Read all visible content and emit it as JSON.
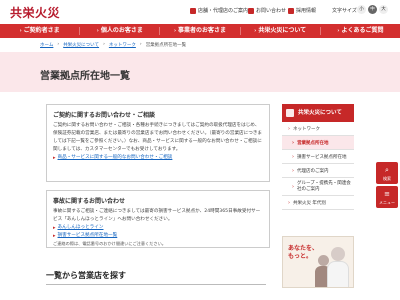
{
  "header": {
    "logo": "共栄火災",
    "util_links": [
      {
        "label": "店舗・代理店のご案内",
        "icon": "location-icon"
      },
      {
        "label": "お問い合わせ",
        "icon": "mail-icon"
      },
      {
        "label": "採用情報",
        "icon": "person-icon"
      }
    ],
    "font_size_label": "文字サイズ",
    "font_sizes": [
      "小",
      "中",
      "大"
    ],
    "font_size_selected": "中"
  },
  "nav": {
    "items": [
      "ご契約者さま",
      "個人のお客さま",
      "事業者のお客さま",
      "共栄火災について",
      "よくあるご質問"
    ]
  },
  "breadcrumb": [
    "ホーム",
    "共栄火災について",
    "ネットワーク",
    "営業拠点所在地一覧"
  ],
  "page": {
    "title": "営業拠点所在地一覧"
  },
  "card1": {
    "title": "ご契約に関するお問い合わせ・ご相談",
    "body": "ご契約に関するお問い合わせ・ご相談・各種お手続きにつきましてはご契約の取扱代理店をはじめ、保険証券記載の営業店、または最寄りの営業店までお問い合わせください。（最寄りの営業店につきましては下記一覧をご参照ください。）なお、商品・サービスに関する一般的なお問い合わせ・ご相談に関しましては、カスタマーセンターでもお受けしております。",
    "link": "商品・サービスに関する一般的なお問い合わせ・ご相談"
  },
  "card2": {
    "title": "事故に関するお問い合わせ",
    "body": "事故に関するご相談・ご連絡につきましては最寄の損害サービス拠点か、24時間365日事故受付サービス「あんしんほっとライン」へお問い合わせください。",
    "links": [
      "あんしんほっとライン",
      "損害サービス拠点所在地一覧"
    ],
    "note": "ご連絡の際は、電話番号のおかけ間違いにご注意ください。"
  },
  "section2": {
    "title": "一覧から営業店を探す"
  },
  "sidebar": {
    "head": "共栄火災について",
    "items": [
      {
        "label": "ネットワーク",
        "active": false,
        "sub": false
      },
      {
        "label": "営業拠点所在地",
        "active": true,
        "sub": true
      },
      {
        "label": "損害サービス拠点所在地",
        "active": false,
        "sub": true
      },
      {
        "label": "代理店のご案内",
        "active": false,
        "sub": true
      },
      {
        "label": "グループ・提携先・関連会社のご案内",
        "active": false,
        "sub": true
      },
      {
        "label": "共栄火災 年代別",
        "active": false,
        "sub": false
      }
    ]
  },
  "banner": {
    "text": "あなたを、\nもっと。"
  },
  "float": {
    "search_label": "検索",
    "menu_label": "メニュー"
  },
  "colors": {
    "brand_red": "#c62828",
    "hero_pink": "#fbe7ea",
    "link_blue": "#1565c0"
  }
}
